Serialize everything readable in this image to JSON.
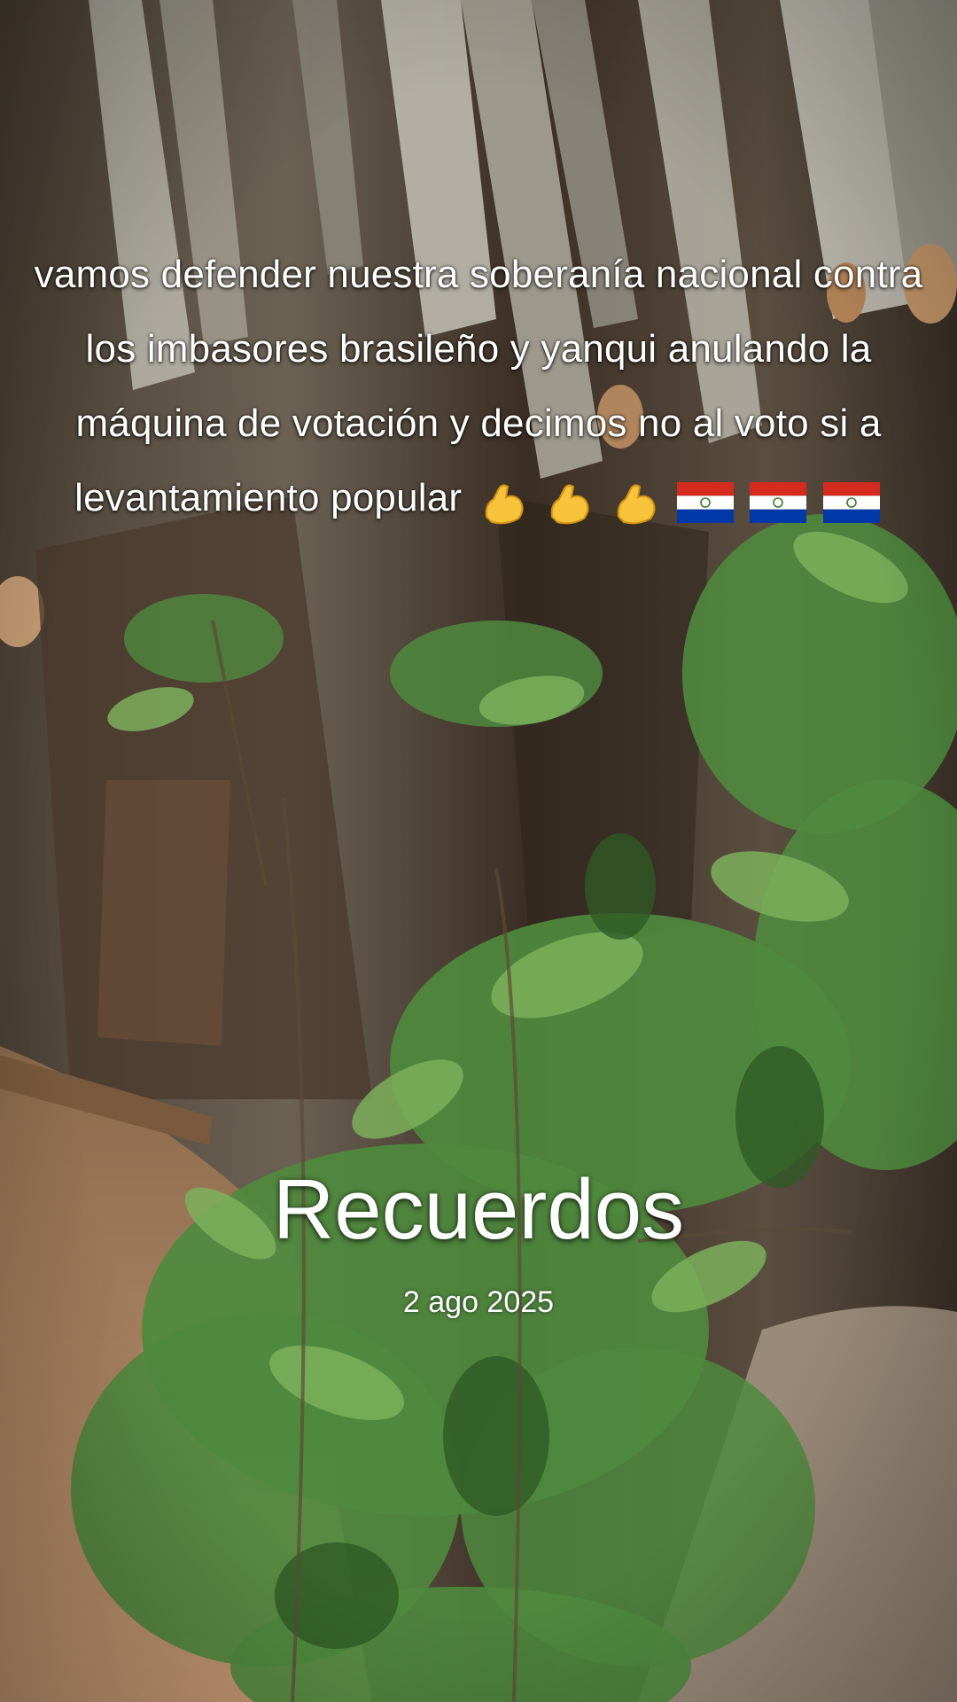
{
  "caption": {
    "text": "vamos defender nuestra soberanía nacional contra los imbasores brasileño y yanqui anulando la máquina de votación y decimos no al voto si a levantamiento popular",
    "emojis": [
      "flexed-biceps",
      "flexed-biceps",
      "flexed-biceps",
      "flag-paraguay",
      "flag-paraguay",
      "flag-paraguay"
    ]
  },
  "memories": {
    "title": "Recuerdos",
    "date": "2 ago 2025"
  },
  "colors": {
    "text": "#ffffff",
    "bark_dark": "#3e3226",
    "bark_light": "#a9a69a",
    "leaf": "#4f8a3e",
    "leaf_light": "#8cc06a",
    "soil": "#b98f68",
    "flag_red": "#d52b1e",
    "flag_blue": "#0038a8",
    "emoji_yellow": "#f7c33a"
  }
}
